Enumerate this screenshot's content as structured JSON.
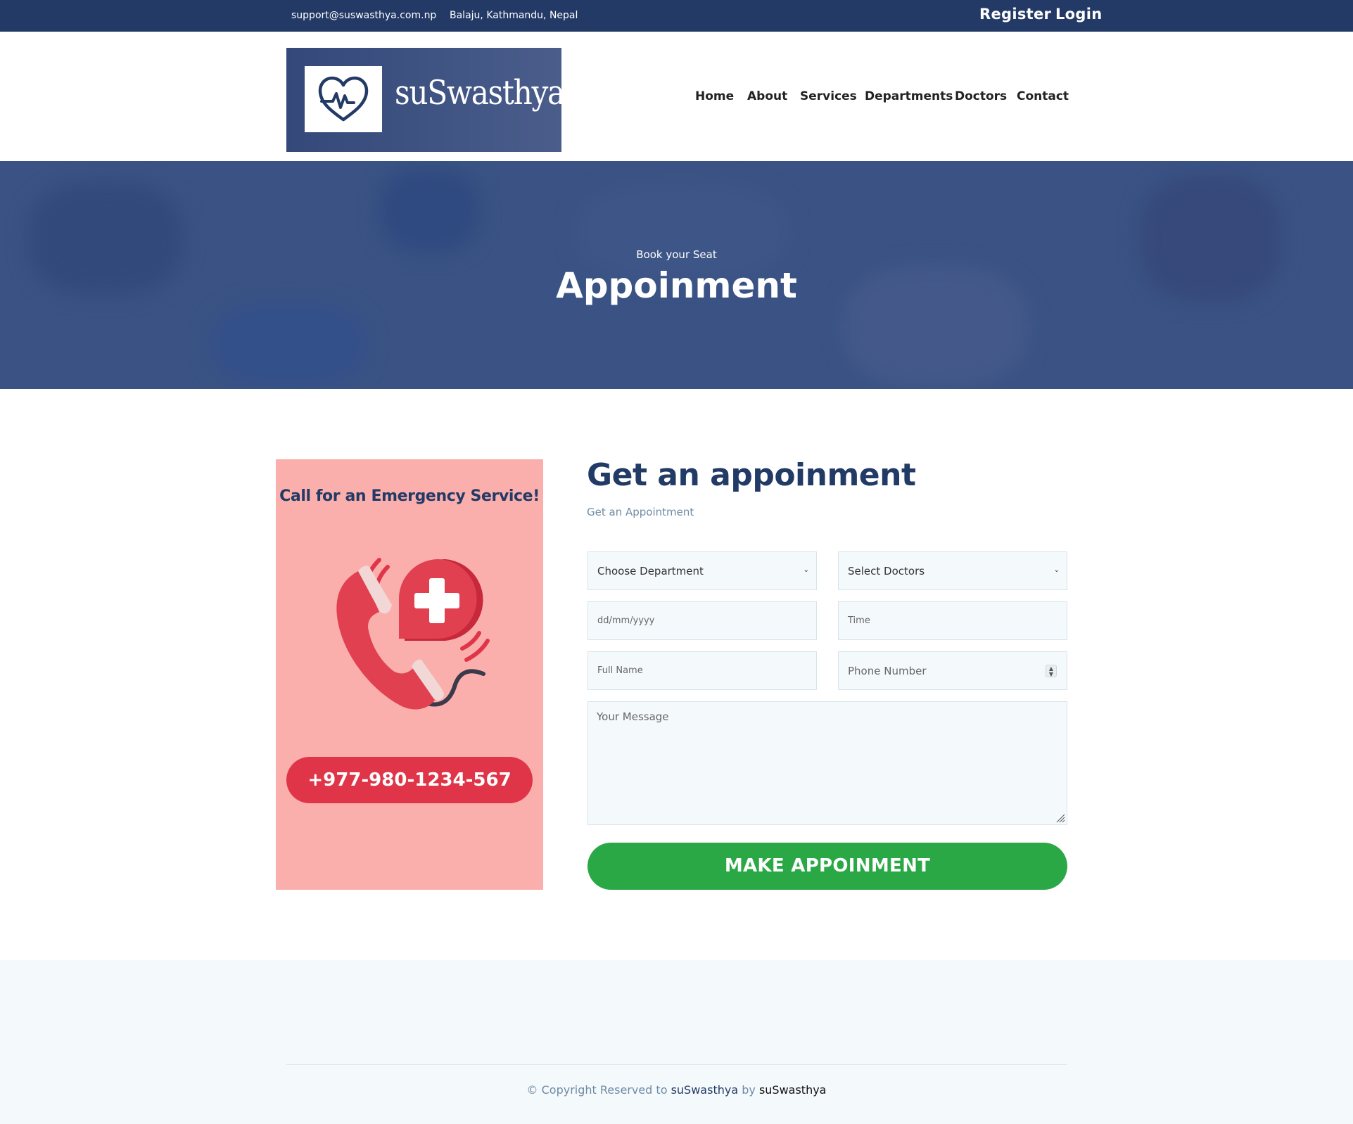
{
  "topbar": {
    "email": "support@suswasthya.com.np",
    "address": "Balaju, Kathmandu, Nepal",
    "register": "Register",
    "login": "Login"
  },
  "logo": {
    "text": "suSwasthya",
    "icon": "heart-pulse-icon"
  },
  "nav": {
    "items": [
      "Home",
      "About",
      "Services",
      "Departments",
      "Doctors",
      "Contact"
    ]
  },
  "hero": {
    "subtitle": "Book your Seat",
    "title": "Appoinment"
  },
  "emergency": {
    "title": "Call for an Emergency Service!",
    "phone": "+977-980-1234-567",
    "icon": "emergency-phone-icon"
  },
  "form": {
    "title": "Get an appoinment",
    "subtitle": "Get an Appointment",
    "department_placeholder": "Choose Department",
    "doctor_placeholder": "Select Doctors",
    "date_placeholder": "dd/mm/yyyy",
    "time_placeholder": "Time",
    "name_placeholder": "Full Name",
    "phone_placeholder": "Phone Number",
    "message_placeholder": "Your Message",
    "submit": "MAKE APPOINMENT"
  },
  "footer": {
    "copyright_prefix": "© Copyright Reserved to",
    "brand": "suSwasthya",
    "by": "by",
    "by_brand": "suSwasthya"
  },
  "colors": {
    "primary": "#223a66",
    "accent_red": "#e03548",
    "card_pink": "#fbafac",
    "success": "#2aa846",
    "muted": "#6f8ba4"
  }
}
